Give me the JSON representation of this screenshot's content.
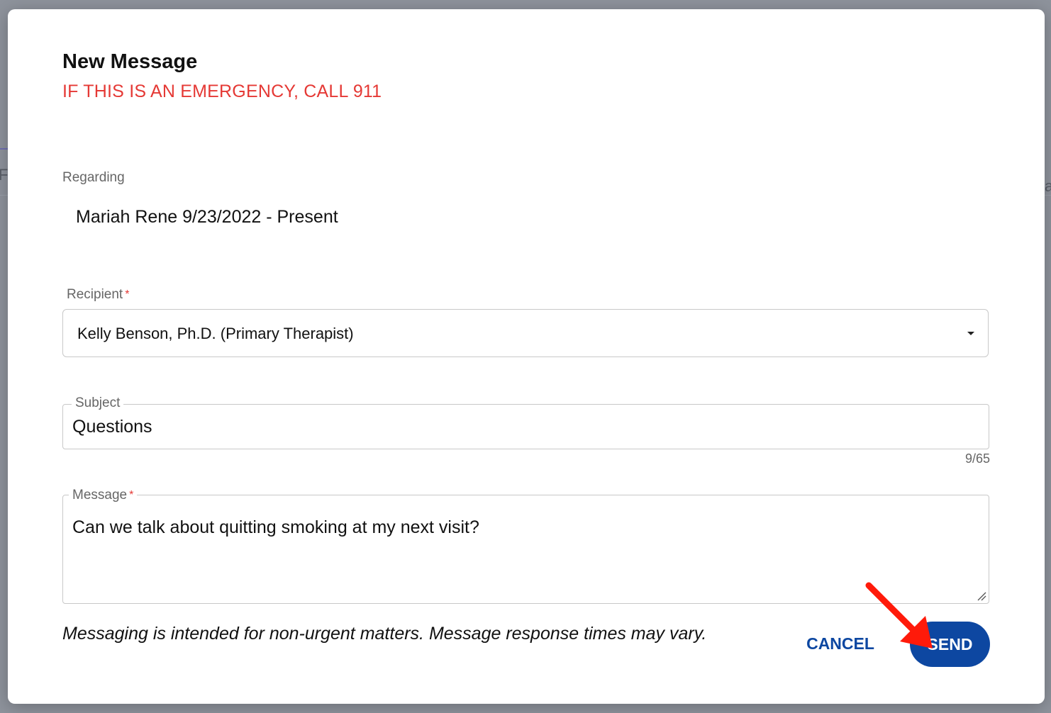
{
  "background": {
    "frag_left": "Fr",
    "frag_right": "ai"
  },
  "dialog": {
    "title": "New Message",
    "emergency_notice": "IF THIS IS AN EMERGENCY, CALL 911",
    "regarding": {
      "label": "Regarding",
      "value": "Mariah Rene 9/23/2022 - Present"
    },
    "recipient": {
      "label": "Recipient",
      "required_mark": "*",
      "selected": "Kelly Benson, Ph.D. (Primary Therapist)"
    },
    "subject": {
      "label": "Subject",
      "value": "Questions",
      "counter": "9/65"
    },
    "message": {
      "label": "Message",
      "required_mark": "*",
      "value": "Can we talk about quitting smoking at my next visit?"
    },
    "disclaimer": "Messaging is intended for non-urgent matters. Message response times may vary.",
    "actions": {
      "cancel_label": "CANCEL",
      "send_label": "SEND"
    }
  },
  "colors": {
    "accent": "#0d47a1",
    "emergency": "#e53935",
    "annotation_arrow": "#ff1a0a",
    "overlay": "#8e939c"
  },
  "icons": {
    "dropdown": "caret-down-icon",
    "resize": "resize-handle-icon",
    "annotation": "red-arrow-icon"
  }
}
